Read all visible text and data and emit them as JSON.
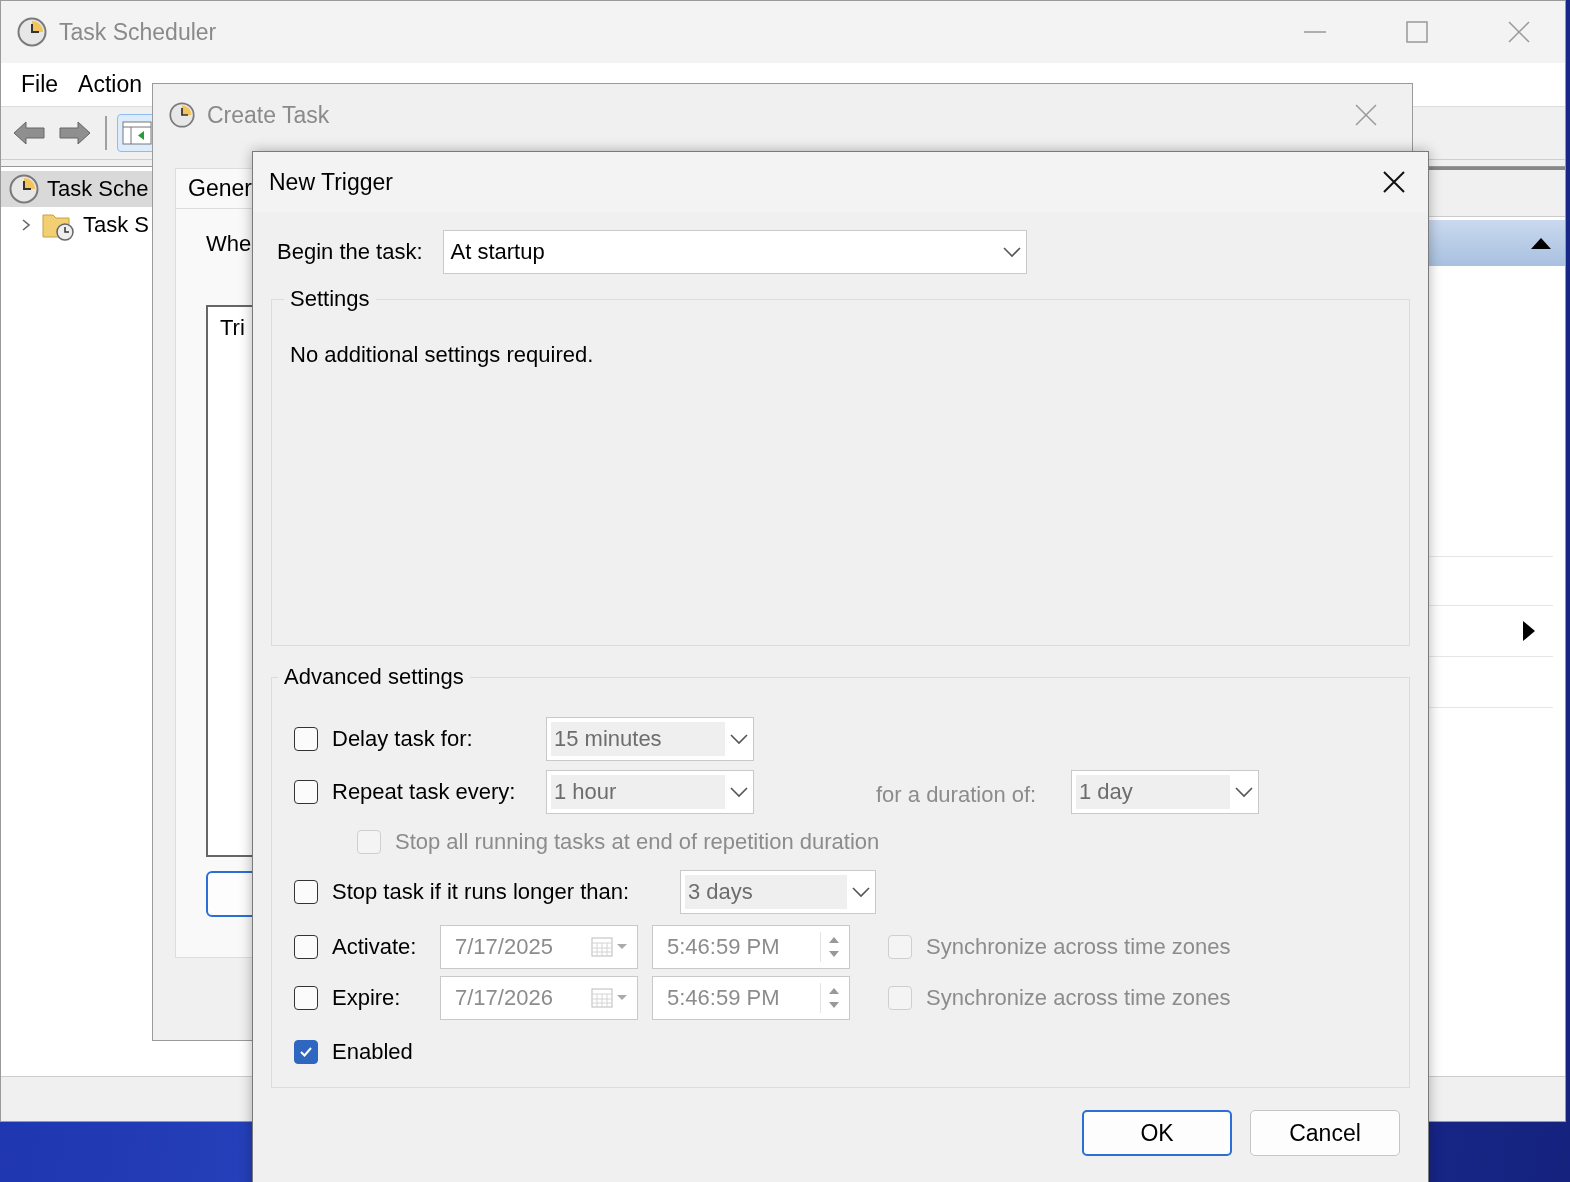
{
  "main_window": {
    "title": "Task Scheduler",
    "menu": [
      "File",
      "Action"
    ],
    "tree": [
      {
        "label": "Task Sche",
        "selected": true,
        "children": [
          {
            "label": "Task S",
            "selected": false,
            "expanded": false
          }
        ]
      }
    ]
  },
  "create_task": {
    "title": "Create Task",
    "tabs": [
      {
        "label": "Gener",
        "selected": true
      }
    ],
    "prompt": "Whe",
    "trigger_list_header": "Tri"
  },
  "new_trigger": {
    "title": "New Trigger",
    "begin_label": "Begin the task:",
    "begin_value": "At startup",
    "settings_title": "Settings",
    "settings_message": "No additional settings required.",
    "advanced_title": "Advanced settings",
    "delay": {
      "label": "Delay task for:",
      "checked": false,
      "value": "15 minutes"
    },
    "repeat": {
      "label": "Repeat task every:",
      "checked": false,
      "value": "1 hour",
      "duration_label": "for a duration of:",
      "duration_value": "1 day"
    },
    "stop_all": {
      "label": "Stop all running tasks at end of repetition duration",
      "checked": false
    },
    "stop_longer": {
      "label": "Stop task if it runs longer than:",
      "checked": false,
      "value": "3 days"
    },
    "activate": {
      "label": "Activate:",
      "checked": false,
      "date": "7/17/2025",
      "time": "5:46:59 PM",
      "sync": {
        "label": "Synchronize across time zones",
        "checked": false
      }
    },
    "expire": {
      "label": "Expire:",
      "checked": false,
      "date": "7/17/2026",
      "time": "5:46:59 PM",
      "sync": {
        "label": "Synchronize across time zones",
        "checked": false
      }
    },
    "enabled": {
      "label": "Enabled",
      "checked": true
    },
    "buttons": [
      {
        "label": "OK",
        "default": true
      },
      {
        "label": "Cancel",
        "default": false
      }
    ]
  }
}
